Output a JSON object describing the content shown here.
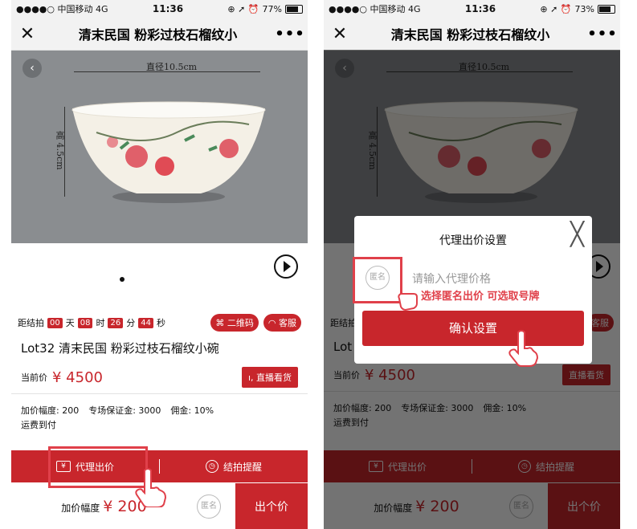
{
  "status_left": {
    "carrier": "●●●●○ 中国移动",
    "network": "4G",
    "time": "11:36",
    "battery": "77%"
  },
  "status_right": {
    "carrier": "●●●●○ 中国移动",
    "network": "4G",
    "time": "11:36",
    "battery": "73%"
  },
  "nav": {
    "close": "✕",
    "title": "清末民国 粉彩过枝石榴纹小",
    "more": "•••"
  },
  "photo": {
    "width_label": "直径10.5cm",
    "height_label": "高 4.5cm",
    "back": "‹"
  },
  "countdown": {
    "prefix": "距结拍",
    "days": "00",
    "day_unit": "天",
    "hours": "08",
    "hour_unit": "时",
    "minutes": "26",
    "minute_unit": "分",
    "seconds": "44",
    "second_unit": "秒",
    "qr": "二维码",
    "service": "客服"
  },
  "lot": {
    "name": "Lot32  清末民国 粉彩过枝石榴纹小碗",
    "price_label": "当前价",
    "price": "¥ 4500",
    "live": "直播看货"
  },
  "info": {
    "increment": "加价幅度: 200",
    "deposit": "专场保证金: 3000",
    "commission": "佣金: 10%",
    "shipping": "运费到付"
  },
  "actions": {
    "proxy_bid": "代理出价",
    "reminder": "结拍提醒",
    "yen_icon": "¥"
  },
  "bottom": {
    "increment_label": "加价幅度",
    "increment_value": "¥ 200",
    "anon": "匿名",
    "bid": "出个价"
  },
  "dialog": {
    "title": "代理出价设置",
    "close": "╳",
    "anon": "匿名",
    "placeholder": "请输入代理价格",
    "confirm": "确认设置"
  },
  "annotation": "选择匿名出价 可选取号牌",
  "colors": {
    "accent": "#c8262c",
    "highlight": "#e0404a"
  },
  "icons": [
    "close-icon",
    "more-icon",
    "back-icon",
    "play-icon",
    "qr-icon",
    "service-icon",
    "live-icon",
    "yen-icon",
    "clock-icon",
    "pointer-hand-icon"
  ]
}
